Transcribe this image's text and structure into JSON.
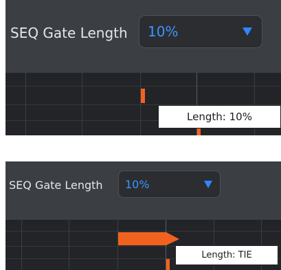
{
  "top_panel": {
    "label": "SEQ Gate Length",
    "dropdown": {
      "value": "10%",
      "icon": "triangle-down-icon",
      "color": "#3d94ff"
    },
    "tooltip": "Length: 10%"
  },
  "bottom_panel": {
    "label": "SEQ Gate Length",
    "dropdown": {
      "value": "10%",
      "icon": "triangle-down-icon",
      "color": "#3d94ff"
    },
    "tooltip": "Length: TIE"
  },
  "colors": {
    "panel_bg": "#3b3e43",
    "grid_bg": "#222427",
    "note_orange": "#f2621f",
    "accent_blue": "#3d94ff"
  }
}
